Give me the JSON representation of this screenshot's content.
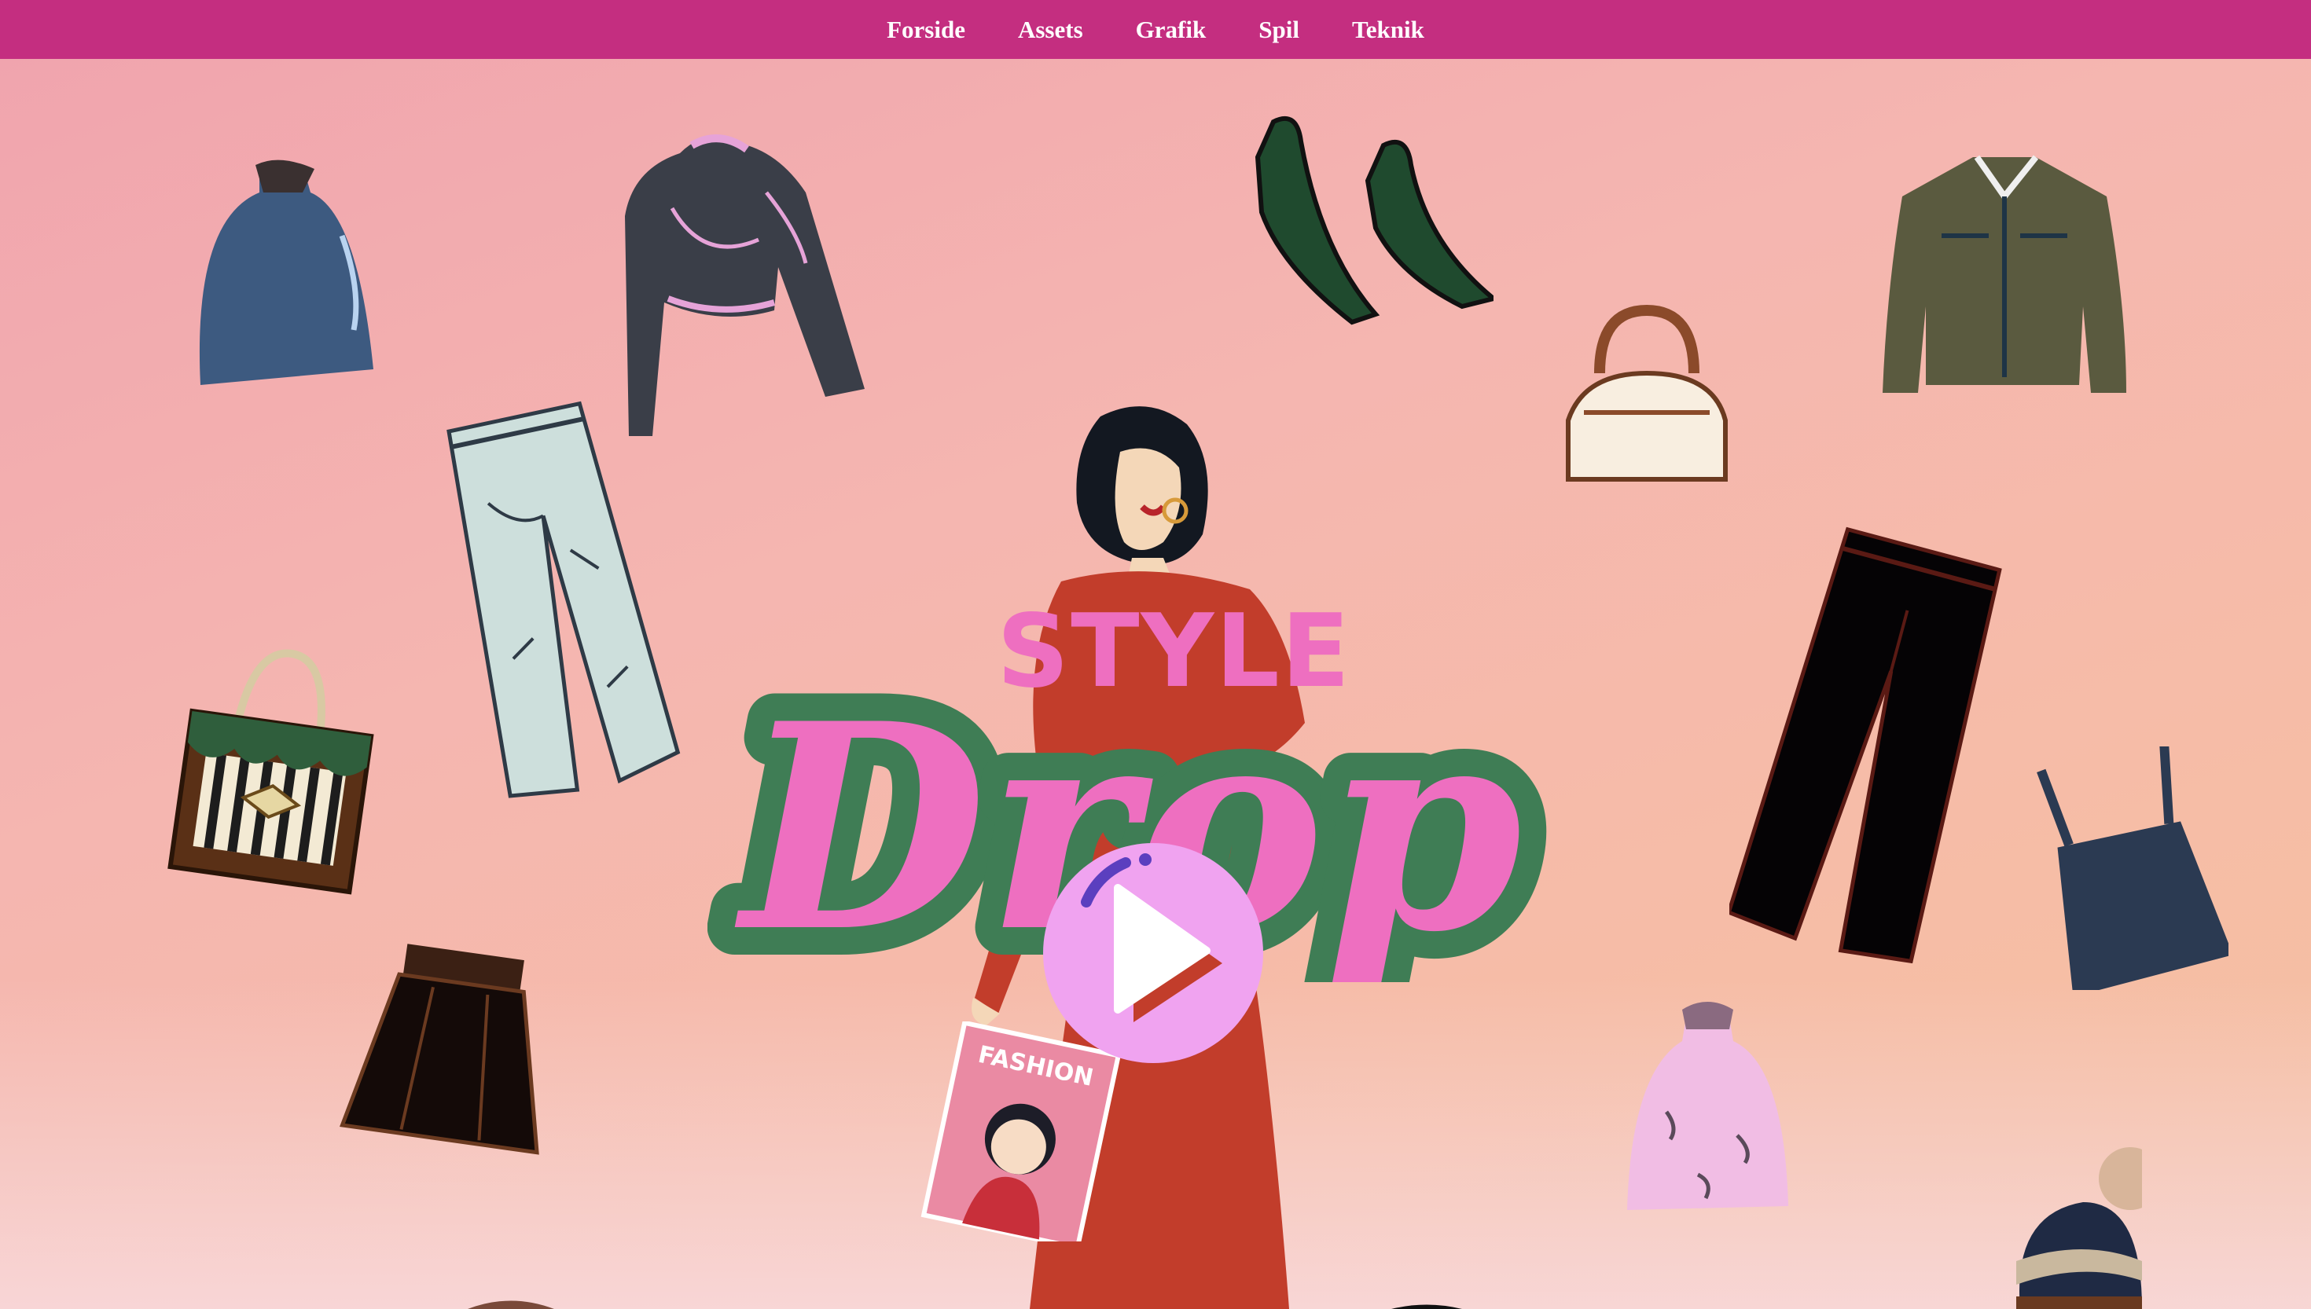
{
  "nav": {
    "items": [
      "Forside",
      "Assets",
      "Grafik",
      "Spil",
      "Teknik"
    ]
  },
  "hero": {
    "title_top": "STYLE",
    "title_main": "Drop",
    "magazine_text": "FASHION"
  },
  "colors": {
    "nav_bg": "#c42e80",
    "title_pink": "#ee6fc0",
    "title_outline": "#3f7d55",
    "play_button": "#f0a3f0"
  },
  "icons": {
    "play": "play-icon"
  }
}
